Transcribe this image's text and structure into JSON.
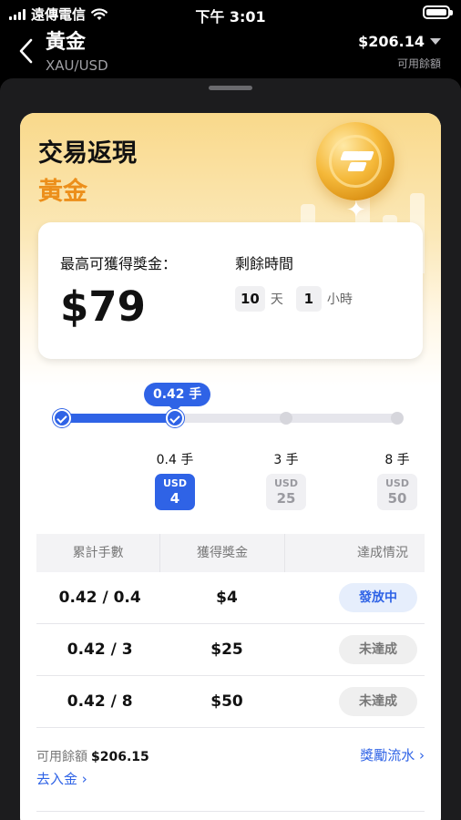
{
  "status_bar": {
    "carrier": "遠傳電信",
    "time": "下午 3:01"
  },
  "nav": {
    "title": "黃金",
    "subtitle": "XAU/USD",
    "balance": "$206.14",
    "balance_label": "可用餘額"
  },
  "hero": {
    "title": "交易返現",
    "asset": "黃金"
  },
  "reward": {
    "max_label": "最高可獲得獎金：",
    "max_value": "$79",
    "time_label": "剩餘時間",
    "days": "10",
    "days_unit": "天",
    "hours": "1",
    "hours_unit": "小時"
  },
  "progress": {
    "current_label": "0.42 手",
    "current_lots": 0.42,
    "tiers": [
      {
        "lots": "0.4 手",
        "currency": "USD",
        "amount": "4",
        "reached": true
      },
      {
        "lots": "3 手",
        "currency": "USD",
        "amount": "25",
        "reached": false
      },
      {
        "lots": "8 手",
        "currency": "USD",
        "amount": "50",
        "reached": false
      }
    ]
  },
  "table": {
    "headers": [
      "累計手數",
      "獲得獎金",
      "達成情況"
    ],
    "rows": [
      {
        "lots": "0.42 / 0.4",
        "bonus": "$4",
        "status": "發放中",
        "status_type": "active"
      },
      {
        "lots": "0.42 / 3",
        "bonus": "$25",
        "status": "未達成",
        "status_type": "pending"
      },
      {
        "lots": "0.42 / 8",
        "bonus": "$50",
        "status": "未達成",
        "status_type": "pending"
      }
    ]
  },
  "footer": {
    "available_label": "可用餘額",
    "available_value": "$206.15",
    "deposit_link": "去入金 ›",
    "history_link": "獎勵流水 ›"
  },
  "colors": {
    "accent": "#2f63e6",
    "gold": "#ec8f1b",
    "sheet_bg": "#1c1c1e"
  }
}
